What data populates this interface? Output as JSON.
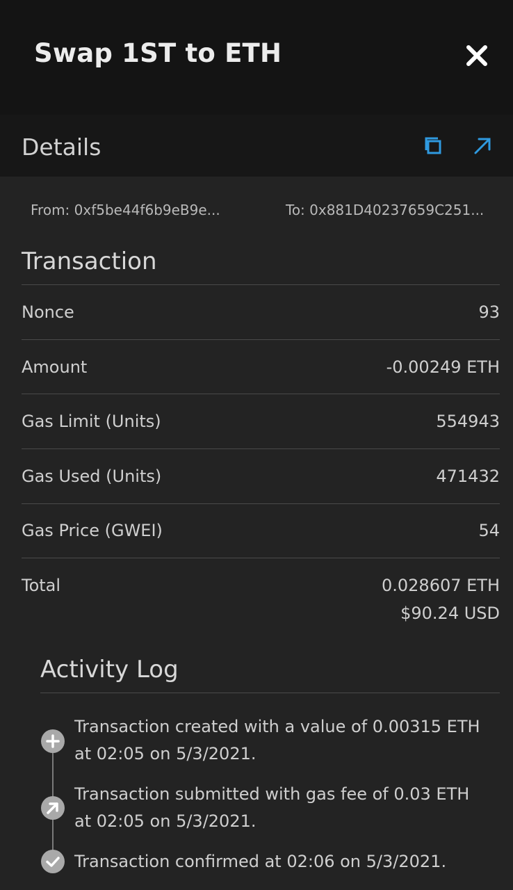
{
  "header": {
    "title": "Swap 1ST to ETH"
  },
  "details": {
    "title": "Details",
    "from": "From: 0xf5be44f6b9eB9e...",
    "to": "To: 0x881D40237659C251..."
  },
  "transaction": {
    "title": "Transaction",
    "rows": [
      {
        "label": "Nonce",
        "value": "93"
      },
      {
        "label": "Amount",
        "value": "-0.00249 ETH"
      },
      {
        "label": "Gas Limit (Units)",
        "value": "554943"
      },
      {
        "label": "Gas Used (Units)",
        "value": "471432"
      },
      {
        "label": "Gas Price (GWEI)",
        "value": "54"
      }
    ],
    "total": {
      "label": "Total",
      "eth": "0.028607 ETH",
      "usd": "$90.24 USD"
    }
  },
  "activity_log": {
    "title": "Activity Log",
    "entries": [
      {
        "icon": "plus-icon",
        "text": "Transaction created with a value of 0.00315 ETH at 02:05 on 5/3/2021."
      },
      {
        "icon": "arrow-up-right-icon",
        "text": "Transaction submitted with gas fee of 0.03 ETH at 02:05 on 5/3/2021."
      },
      {
        "icon": "check-icon",
        "text": "Transaction confirmed at 02:06 on 5/3/2021."
      }
    ]
  },
  "colors": {
    "header_bg": "#141414",
    "panel_bg": "#232323",
    "accent": "#2f9ae0"
  }
}
